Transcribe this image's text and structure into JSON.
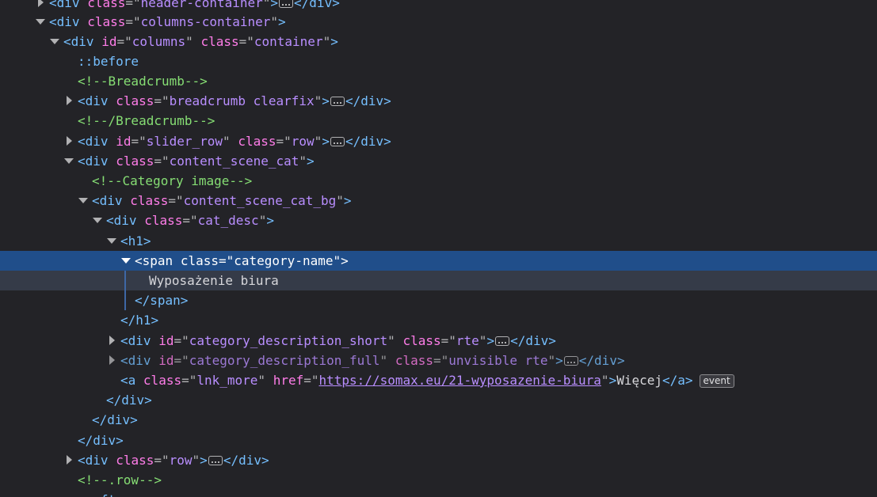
{
  "colors": {
    "background": "#232327",
    "selected_row": "#204e8a",
    "hovered_row": "#353b48",
    "tag": "#75bfff",
    "attr_name": "#ff7de9",
    "attr_value": "#b98eff",
    "comment": "#86de74"
  },
  "nodes": {
    "n0": {
      "tag": "div",
      "class_attr": "class",
      "class_val": "header-container"
    },
    "n1": {
      "tag": "div",
      "class_attr": "class",
      "class_val": "columns-container"
    },
    "n2": {
      "tag": "div",
      "id_attr": "id",
      "id_val": "columns",
      "class_attr": "class",
      "class_val": "container"
    },
    "n3": {
      "pseudo": "::before"
    },
    "n4": {
      "comment": "<!--Breadcrumb-->"
    },
    "n5": {
      "tag": "div",
      "class_attr": "class",
      "class_val": "breadcrumb clearfix"
    },
    "n6": {
      "comment": "<!--/Breadcrumb-->"
    },
    "n7": {
      "tag": "div",
      "id_attr": "id",
      "id_val": "slider_row",
      "class_attr": "class",
      "class_val": "row"
    },
    "n8": {
      "tag": "div",
      "class_attr": "class",
      "class_val": "content_scene_cat"
    },
    "n9": {
      "comment": "<!--Category image-->"
    },
    "n10": {
      "tag": "div",
      "class_attr": "class",
      "class_val": "content_scene_cat_bg"
    },
    "n11": {
      "tag": "div",
      "class_attr": "class",
      "class_val": "cat_desc"
    },
    "n12": {
      "tag": "h1"
    },
    "n13": {
      "tag": "span",
      "class_attr": "class",
      "class_val": "category-name"
    },
    "n14": {
      "text": "Wyposażenie biura"
    },
    "n15": {
      "tag": "span"
    },
    "n16": {
      "tag": "h1"
    },
    "n17": {
      "tag": "div",
      "id_attr": "id",
      "id_val": "category_description_short",
      "class_attr": "class",
      "class_val": "rte"
    },
    "n18": {
      "tag": "div",
      "id_attr": "id",
      "id_val": "category_description_full",
      "class_attr": "class",
      "class_val": "unvisible rte"
    },
    "n19": {
      "tag": "a",
      "close_tag": "a",
      "class_attr": "class",
      "class_val": "lnk_more",
      "href_attr": "href",
      "href_val": "https://somax.eu/21-wyposazenie-biura",
      "text": "Więcej",
      "badge": "event"
    },
    "n20": {
      "tag": "div"
    },
    "n21": {
      "tag": "div"
    },
    "n22": {
      "tag": "div"
    },
    "n23": {
      "tag": "div",
      "class_attr": "class",
      "class_val": "row"
    },
    "n24": {
      "comment": "<!--.row-->"
    },
    "n25": {
      "pseudo": "::after"
    }
  }
}
